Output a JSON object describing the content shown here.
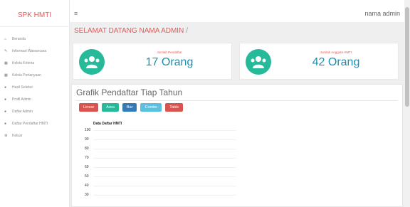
{
  "brand": "SPK HMTI",
  "sidebar": {
    "items": [
      {
        "icon": "home-icon",
        "label": "Beranda"
      },
      {
        "icon": "edit-icon",
        "label": "Informasi Wawancara"
      },
      {
        "icon": "table-icon",
        "label": "Kelola Kriteria"
      },
      {
        "icon": "table-icon",
        "label": "Kelola Pertanyaan"
      },
      {
        "icon": "users-icon",
        "label": "Hasil Seleksi"
      },
      {
        "icon": "users-icon",
        "label": "Profil Admin"
      },
      {
        "icon": "users-icon",
        "label": "Daftar Admin"
      },
      {
        "icon": "users-icon",
        "label": "Daftar Pendaftar HMTI"
      },
      {
        "icon": "gear-icon",
        "label": "Keluar"
      }
    ]
  },
  "topbar": {
    "admin": "nama admin"
  },
  "welcome": {
    "title": "SELAMAT DATANG NAMA ADMIN",
    "separator": "/"
  },
  "stats": [
    {
      "label": "Jumlah Pendaftar",
      "value": "17 Orang"
    },
    {
      "label": "Jumlah Anggota HMTI",
      "value": "42 Orang"
    }
  ],
  "panel": {
    "title": "Grafik Pendaftar Tiap Tahun"
  },
  "buttons": [
    {
      "label": "Linear",
      "color": "#d9534f"
    },
    {
      "label": "Area",
      "color": "#26b99a"
    },
    {
      "label": "Bar",
      "color": "#337ab7"
    },
    {
      "label": "Combo",
      "color": "#5bc0de"
    },
    {
      "label": "Table",
      "color": "#d9534f"
    }
  ],
  "chart_data": {
    "type": "line",
    "title": "Data Daftar HMTI",
    "yticks": [
      "100",
      "90",
      "80",
      "70",
      "60",
      "50",
      "40",
      "30"
    ]
  }
}
